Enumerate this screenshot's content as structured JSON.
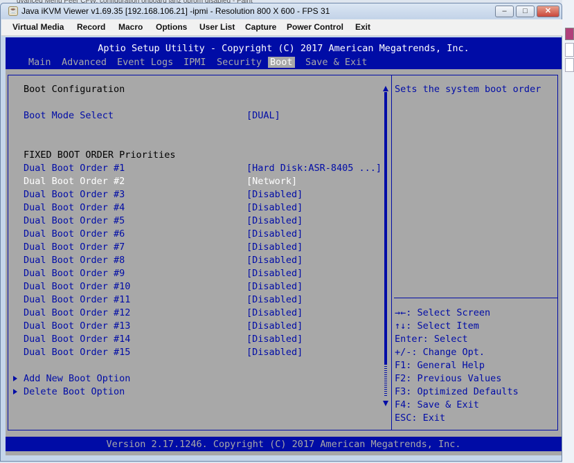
{
  "window": {
    "background_title": "dvanced Menu Peer CFW. configuration onboard lanz oprom disabled - Paint",
    "title": "Java iKVM Viewer v1.69.35 [192.168.106.21] -ipmi - Resolution 800 X 600 - FPS 31",
    "minimize": "–",
    "maximize": "□",
    "close": "✕"
  },
  "menubar": {
    "items": [
      "Virtual Media",
      "Record",
      "Macro",
      "Options",
      "User List",
      "Capture",
      "Power Control",
      "Exit"
    ]
  },
  "bios": {
    "header_title": "Aptio Setup Utility - Copyright (C) 2017 American Megatrends, Inc.",
    "tabs": [
      "Main",
      "Advanced",
      "Event Logs",
      "IPMI",
      "Security",
      "Boot",
      "Save & Exit"
    ],
    "active_tab": "Boot",
    "section_title": "Boot Configuration",
    "boot_mode_label": "Boot Mode Select",
    "boot_mode_value": "[DUAL]",
    "fixed_order_title": "FIXED BOOT ORDER Priorities",
    "boot_orders": [
      {
        "label": "Dual Boot Order #1",
        "value": "[Hard Disk:ASR-8405 ...]"
      },
      {
        "label": "Dual Boot Order #2",
        "value": "[Network]"
      },
      {
        "label": "Dual Boot Order #3",
        "value": "[Disabled]"
      },
      {
        "label": "Dual Boot Order #4",
        "value": "[Disabled]"
      },
      {
        "label": "Dual Boot Order #5",
        "value": "[Disabled]"
      },
      {
        "label": "Dual Boot Order #6",
        "value": "[Disabled]"
      },
      {
        "label": "Dual Boot Order #7",
        "value": "[Disabled]"
      },
      {
        "label": "Dual Boot Order #8",
        "value": "[Disabled]"
      },
      {
        "label": "Dual Boot Order #9",
        "value": "[Disabled]"
      },
      {
        "label": "Dual Boot Order #10",
        "value": "[Disabled]"
      },
      {
        "label": "Dual Boot Order #11",
        "value": "[Disabled]"
      },
      {
        "label": "Dual Boot Order #12",
        "value": "[Disabled]"
      },
      {
        "label": "Dual Boot Order #13",
        "value": "[Disabled]"
      },
      {
        "label": "Dual Boot Order #14",
        "value": "[Disabled]"
      },
      {
        "label": "Dual Boot Order #15",
        "value": "[Disabled]"
      }
    ],
    "selected_index": 1,
    "submenus": [
      "Add New Boot Option",
      "Delete Boot Option"
    ],
    "help_text": "Sets the system boot order",
    "key_help": [
      "→←: Select Screen",
      "↑↓: Select Item",
      "Enter: Select",
      "+/-: Change Opt.",
      "F1: General Help",
      "F2: Previous Values",
      "F3: Optimized Defaults",
      "F4: Save & Exit",
      "ESC: Exit"
    ],
    "footer": "Version 2.17.1246. Copyright (C) 2017 American Megatrends, Inc."
  },
  "colors": {
    "bios_blue": "#000ca6",
    "bios_gray": "#a8a8a8",
    "highlight_white": "#ffffff"
  }
}
